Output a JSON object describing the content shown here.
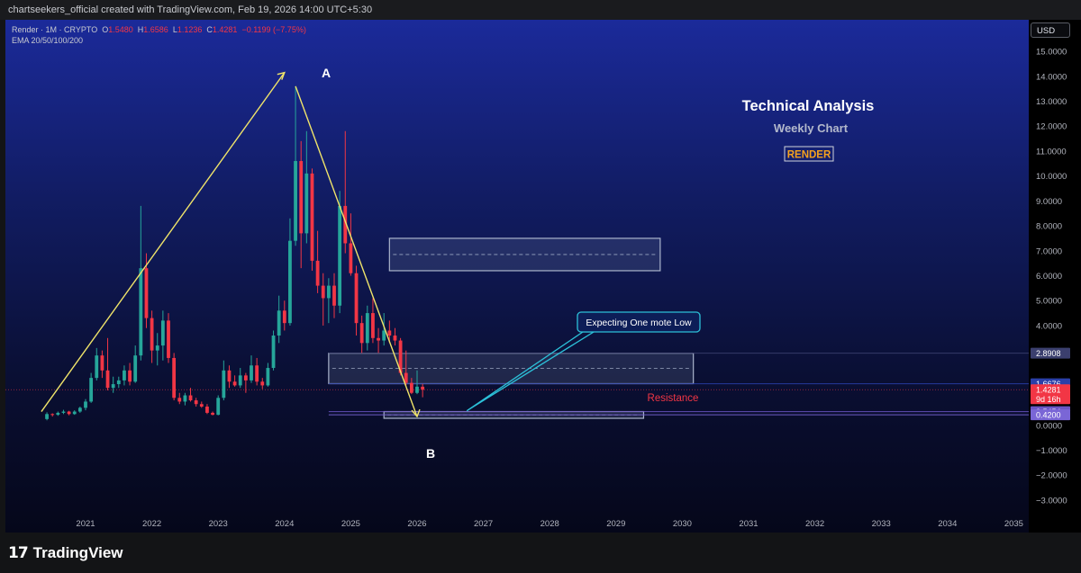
{
  "header": {
    "caption": "chartseekers_official created with TradingView.com, Feb 19, 2026 14:00 UTC+5:30"
  },
  "legend": {
    "symbol": "Render · 1M · CRYPTO",
    "o_label": "O",
    "o": "1.5480",
    "h_label": "H",
    "h": "1.6586",
    "l_label": "L",
    "l": "1.1236",
    "c_label": "C",
    "c": "1.4281",
    "change": "−0.1199 (−7.75%)",
    "indicator": "EMA 20/50/100/200"
  },
  "currency_button": "USD",
  "footer": {
    "logo": "17",
    "brand": "TradingView"
  },
  "colors": {
    "up": "#26a69a",
    "down": "#f23645",
    "wave": "#f0e46a",
    "callout": "#2cc0d8",
    "accent": "#f6a21e"
  },
  "chart_data": {
    "type": "candlestick",
    "interval": "1M",
    "annotations_text": {
      "title": "Technical Analysis",
      "subtitle": "Weekly Chart",
      "tag": "RENDER",
      "a_label": "A",
      "b_label": "B",
      "resistance": "Resistance",
      "callout": "Expecting One mote Low"
    },
    "x_ticks": [
      "2021",
      "2022",
      "2023",
      "2024",
      "2025",
      "2026",
      "2027",
      "2028",
      "2029",
      "2030",
      "2031",
      "2032",
      "2033",
      "2034",
      "2035"
    ],
    "y_ticks": [
      {
        "v": 15,
        "t": "15.0000"
      },
      {
        "v": 14,
        "t": "14.0000"
      },
      {
        "v": 13,
        "t": "13.0000"
      },
      {
        "v": 12,
        "t": "12.0000"
      },
      {
        "v": 11,
        "t": "11.0000"
      },
      {
        "v": 10,
        "t": "10.0000"
      },
      {
        "v": 9,
        "t": "9.0000"
      },
      {
        "v": 8,
        "t": "8.0000"
      },
      {
        "v": 7,
        "t": "7.0000"
      },
      {
        "v": 6,
        "t": "6.0000"
      },
      {
        "v": 5,
        "t": "5.0000"
      },
      {
        "v": 4,
        "t": "4.0000"
      },
      {
        "v": 0,
        "t": "0.0000"
      },
      {
        "v": -1,
        "t": "−1.0000"
      },
      {
        "v": -2,
        "t": "−2.0000"
      },
      {
        "v": -3,
        "t": "−3.0000"
      }
    ],
    "y_range": [
      -3.4,
      15.4
    ],
    "price_tags": [
      {
        "value": 2.8908,
        "text": "2.8908",
        "sub": "",
        "color": "#3b3f6e"
      },
      {
        "value": 1.6676,
        "text": "1.6676",
        "sub": "",
        "color": "#2a3fa8"
      },
      {
        "value": 1.4281,
        "text": "1.4281",
        "sub": "9d 16h",
        "color": "#f23645"
      },
      {
        "value": 0.5454,
        "text": "0.5454",
        "sub": "",
        "color": "#6a55c4"
      },
      {
        "value": 0.42,
        "text": "0.4200",
        "sub": "",
        "color": "#7a66d6"
      }
    ],
    "zones": [
      {
        "x0": "2025-08",
        "x1": "2029-09",
        "y0": 6.2,
        "y1": 7.5
      },
      {
        "x0": "2024-09",
        "x1": "2030-03",
        "y0": 1.67,
        "y1": 2.89
      },
      {
        "x0": "2025-07",
        "x1": "2029-06",
        "y0": 0.28,
        "y1": 0.55
      }
    ],
    "wave_path": [
      {
        "t": "2020-05",
        "p": 0.55
      },
      {
        "t": "2024-01",
        "p": 14.15
      },
      {
        "t": "2024-03",
        "p": 13.6
      },
      {
        "t": "2026-01",
        "p": 0.35
      }
    ],
    "callout_point": {
      "t": "2026-10",
      "p": 0.58
    },
    "candles": [
      {
        "t": "2020-06",
        "o": 0.25,
        "h": 0.52,
        "l": 0.2,
        "c": 0.45
      },
      {
        "t": "2020-07",
        "o": 0.45,
        "h": 0.48,
        "l": 0.35,
        "c": 0.42
      },
      {
        "t": "2020-08",
        "o": 0.42,
        "h": 0.55,
        "l": 0.38,
        "c": 0.5
      },
      {
        "t": "2020-09",
        "o": 0.5,
        "h": 0.62,
        "l": 0.45,
        "c": 0.55
      },
      {
        "t": "2020-10",
        "o": 0.55,
        "h": 0.58,
        "l": 0.4,
        "c": 0.45
      },
      {
        "t": "2020-11",
        "o": 0.45,
        "h": 0.6,
        "l": 0.42,
        "c": 0.55
      },
      {
        "t": "2020-12",
        "o": 0.55,
        "h": 0.75,
        "l": 0.5,
        "c": 0.7
      },
      {
        "t": "2021-01",
        "o": 0.7,
        "h": 1.05,
        "l": 0.6,
        "c": 0.95
      },
      {
        "t": "2021-02",
        "o": 0.95,
        "h": 2.1,
        "l": 0.9,
        "c": 1.9
      },
      {
        "t": "2021-03",
        "o": 1.9,
        "h": 3.1,
        "l": 1.8,
        "c": 2.8
      },
      {
        "t": "2021-04",
        "o": 2.8,
        "h": 3.0,
        "l": 1.9,
        "c": 2.2
      },
      {
        "t": "2021-05",
        "o": 2.2,
        "h": 3.5,
        "l": 1.4,
        "c": 1.5
      },
      {
        "t": "2021-06",
        "o": 1.5,
        "h": 1.95,
        "l": 1.3,
        "c": 1.65
      },
      {
        "t": "2021-07",
        "o": 1.65,
        "h": 1.95,
        "l": 1.5,
        "c": 1.8
      },
      {
        "t": "2021-08",
        "o": 1.8,
        "h": 2.4,
        "l": 1.6,
        "c": 2.2
      },
      {
        "t": "2021-09",
        "o": 2.2,
        "h": 2.5,
        "l": 1.6,
        "c": 1.75
      },
      {
        "t": "2021-10",
        "o": 1.75,
        "h": 3.2,
        "l": 1.7,
        "c": 2.8
      },
      {
        "t": "2021-11",
        "o": 2.8,
        "h": 8.8,
        "l": 2.6,
        "c": 6.3
      },
      {
        "t": "2021-12",
        "o": 6.3,
        "h": 6.9,
        "l": 3.9,
        "c": 4.3
      },
      {
        "t": "2022-01",
        "o": 4.3,
        "h": 4.6,
        "l": 2.5,
        "c": 3.0
      },
      {
        "t": "2022-02",
        "o": 3.0,
        "h": 3.7,
        "l": 2.4,
        "c": 3.2
      },
      {
        "t": "2022-03",
        "o": 3.2,
        "h": 4.6,
        "l": 2.6,
        "c": 4.2
      },
      {
        "t": "2022-04",
        "o": 4.2,
        "h": 4.5,
        "l": 2.5,
        "c": 2.7
      },
      {
        "t": "2022-05",
        "o": 2.7,
        "h": 2.9,
        "l": 1.0,
        "c": 1.1
      },
      {
        "t": "2022-06",
        "o": 1.1,
        "h": 1.3,
        "l": 0.85,
        "c": 0.95
      },
      {
        "t": "2022-07",
        "o": 0.95,
        "h": 1.3,
        "l": 0.8,
        "c": 1.2
      },
      {
        "t": "2022-08",
        "o": 1.2,
        "h": 1.5,
        "l": 0.95,
        "c": 1.0
      },
      {
        "t": "2022-09",
        "o": 1.0,
        "h": 1.1,
        "l": 0.75,
        "c": 0.85
      },
      {
        "t": "2022-10",
        "o": 0.85,
        "h": 0.95,
        "l": 0.7,
        "c": 0.75
      },
      {
        "t": "2022-11",
        "o": 0.75,
        "h": 0.85,
        "l": 0.45,
        "c": 0.5
      },
      {
        "t": "2022-12",
        "o": 0.5,
        "h": 0.55,
        "l": 0.4,
        "c": 0.42
      },
      {
        "t": "2023-01",
        "o": 0.42,
        "h": 1.2,
        "l": 0.4,
        "c": 1.1
      },
      {
        "t": "2023-02",
        "o": 1.1,
        "h": 2.6,
        "l": 1.0,
        "c": 2.2
      },
      {
        "t": "2023-03",
        "o": 2.2,
        "h": 2.4,
        "l": 1.5,
        "c": 1.75
      },
      {
        "t": "2023-04",
        "o": 1.75,
        "h": 2.0,
        "l": 1.55,
        "c": 1.6
      },
      {
        "t": "2023-05",
        "o": 1.6,
        "h": 2.3,
        "l": 1.5,
        "c": 2.0
      },
      {
        "t": "2023-06",
        "o": 2.0,
        "h": 2.1,
        "l": 1.3,
        "c": 1.8
      },
      {
        "t": "2023-07",
        "o": 1.8,
        "h": 2.8,
        "l": 1.7,
        "c": 2.4
      },
      {
        "t": "2023-08",
        "o": 2.4,
        "h": 2.7,
        "l": 1.6,
        "c": 1.75
      },
      {
        "t": "2023-09",
        "o": 1.75,
        "h": 1.9,
        "l": 1.45,
        "c": 1.6
      },
      {
        "t": "2023-10",
        "o": 1.6,
        "h": 2.5,
        "l": 1.55,
        "c": 2.3
      },
      {
        "t": "2023-11",
        "o": 2.3,
        "h": 3.8,
        "l": 2.2,
        "c": 3.6
      },
      {
        "t": "2023-12",
        "o": 3.6,
        "h": 5.2,
        "l": 3.3,
        "c": 4.6
      },
      {
        "t": "2024-01",
        "o": 4.6,
        "h": 5.0,
        "l": 3.8,
        "c": 4.1
      },
      {
        "t": "2024-02",
        "o": 4.1,
        "h": 8.3,
        "l": 4.0,
        "c": 7.4
      },
      {
        "t": "2024-03",
        "o": 7.4,
        "h": 13.6,
        "l": 7.2,
        "c": 10.6
      },
      {
        "t": "2024-04",
        "o": 10.6,
        "h": 11.4,
        "l": 6.3,
        "c": 7.7
      },
      {
        "t": "2024-05",
        "o": 7.7,
        "h": 11.8,
        "l": 7.3,
        "c": 10.1
      },
      {
        "t": "2024-06",
        "o": 10.1,
        "h": 10.3,
        "l": 6.2,
        "c": 6.6
      },
      {
        "t": "2024-07",
        "o": 6.6,
        "h": 7.8,
        "l": 5.3,
        "c": 5.6
      },
      {
        "t": "2024-08",
        "o": 5.6,
        "h": 6.1,
        "l": 4.0,
        "c": 5.1
      },
      {
        "t": "2024-09",
        "o": 5.1,
        "h": 5.9,
        "l": 4.1,
        "c": 5.6
      },
      {
        "t": "2024-10",
        "o": 5.6,
        "h": 6.1,
        "l": 4.3,
        "c": 4.8
      },
      {
        "t": "2024-11",
        "o": 4.8,
        "h": 9.4,
        "l": 4.5,
        "c": 8.8
      },
      {
        "t": "2024-12",
        "o": 8.8,
        "h": 11.8,
        "l": 6.9,
        "c": 7.3
      },
      {
        "t": "2025-01",
        "o": 7.3,
        "h": 8.5,
        "l": 6.0,
        "c": 6.1
      },
      {
        "t": "2025-02",
        "o": 6.1,
        "h": 6.4,
        "l": 3.6,
        "c": 4.1
      },
      {
        "t": "2025-03",
        "o": 4.1,
        "h": 4.4,
        "l": 2.9,
        "c": 3.3
      },
      {
        "t": "2025-04",
        "o": 3.3,
        "h": 4.8,
        "l": 3.0,
        "c": 4.5
      },
      {
        "t": "2025-05",
        "o": 4.5,
        "h": 5.1,
        "l": 3.3,
        "c": 3.5
      },
      {
        "t": "2025-06",
        "o": 3.5,
        "h": 3.9,
        "l": 2.9,
        "c": 3.4
      },
      {
        "t": "2025-07",
        "o": 3.4,
        "h": 4.5,
        "l": 3.2,
        "c": 3.8
      },
      {
        "t": "2025-08",
        "o": 3.8,
        "h": 4.2,
        "l": 3.3,
        "c": 3.6
      },
      {
        "t": "2025-09",
        "o": 3.6,
        "h": 3.9,
        "l": 3.2,
        "c": 3.4
      },
      {
        "t": "2025-10",
        "o": 3.4,
        "h": 3.5,
        "l": 2.0,
        "c": 2.1
      },
      {
        "t": "2025-11",
        "o": 2.1,
        "h": 3.0,
        "l": 1.6,
        "c": 1.7
      },
      {
        "t": "2025-12",
        "o": 1.7,
        "h": 1.9,
        "l": 1.25,
        "c": 1.3
      },
      {
        "t": "2026-01",
        "o": 1.3,
        "h": 2.2,
        "l": 1.25,
        "c": 1.55
      },
      {
        "t": "2026-02",
        "o": 1.548,
        "h": 1.6586,
        "l": 1.1236,
        "c": 1.4281
      }
    ]
  }
}
